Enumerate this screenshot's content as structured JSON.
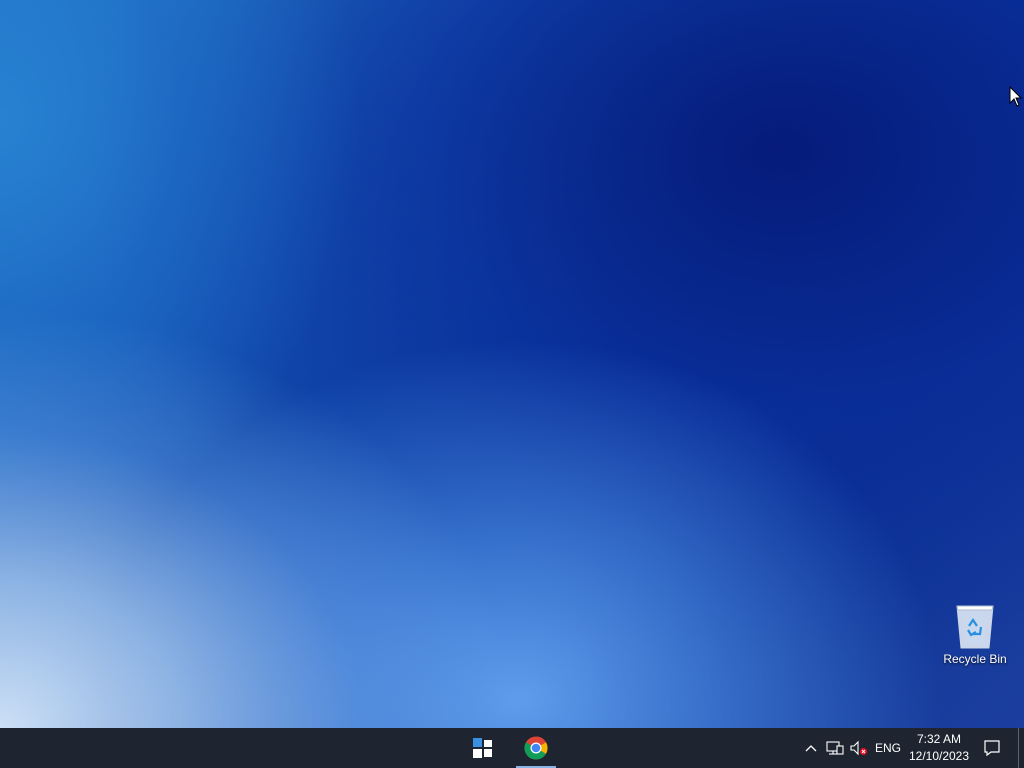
{
  "desktop": {
    "icons": [
      {
        "label": "Recycle Bin",
        "icon": "recycle-bin-icon"
      }
    ]
  },
  "taskbar": {
    "start_icon": "windows-start-icon",
    "pinned_apps": [
      {
        "icon": "chrome-icon",
        "active": true
      }
    ],
    "tray": {
      "chevron_icon": "chevron-up-icon",
      "network_icon": "network-icon",
      "volume_icon": "volume-muted-icon",
      "language": "ENG",
      "time": "7:32 AM",
      "date": "12/10/2023",
      "notification_icon": "notification-icon"
    }
  },
  "colors": {
    "taskbar_bg": "#1f2530",
    "start_accent": "#3a8fe0",
    "chrome_red": "#db4437",
    "chrome_yellow": "#f4b400",
    "chrome_green": "#0f9d58",
    "chrome_blue": "#4285f4"
  }
}
